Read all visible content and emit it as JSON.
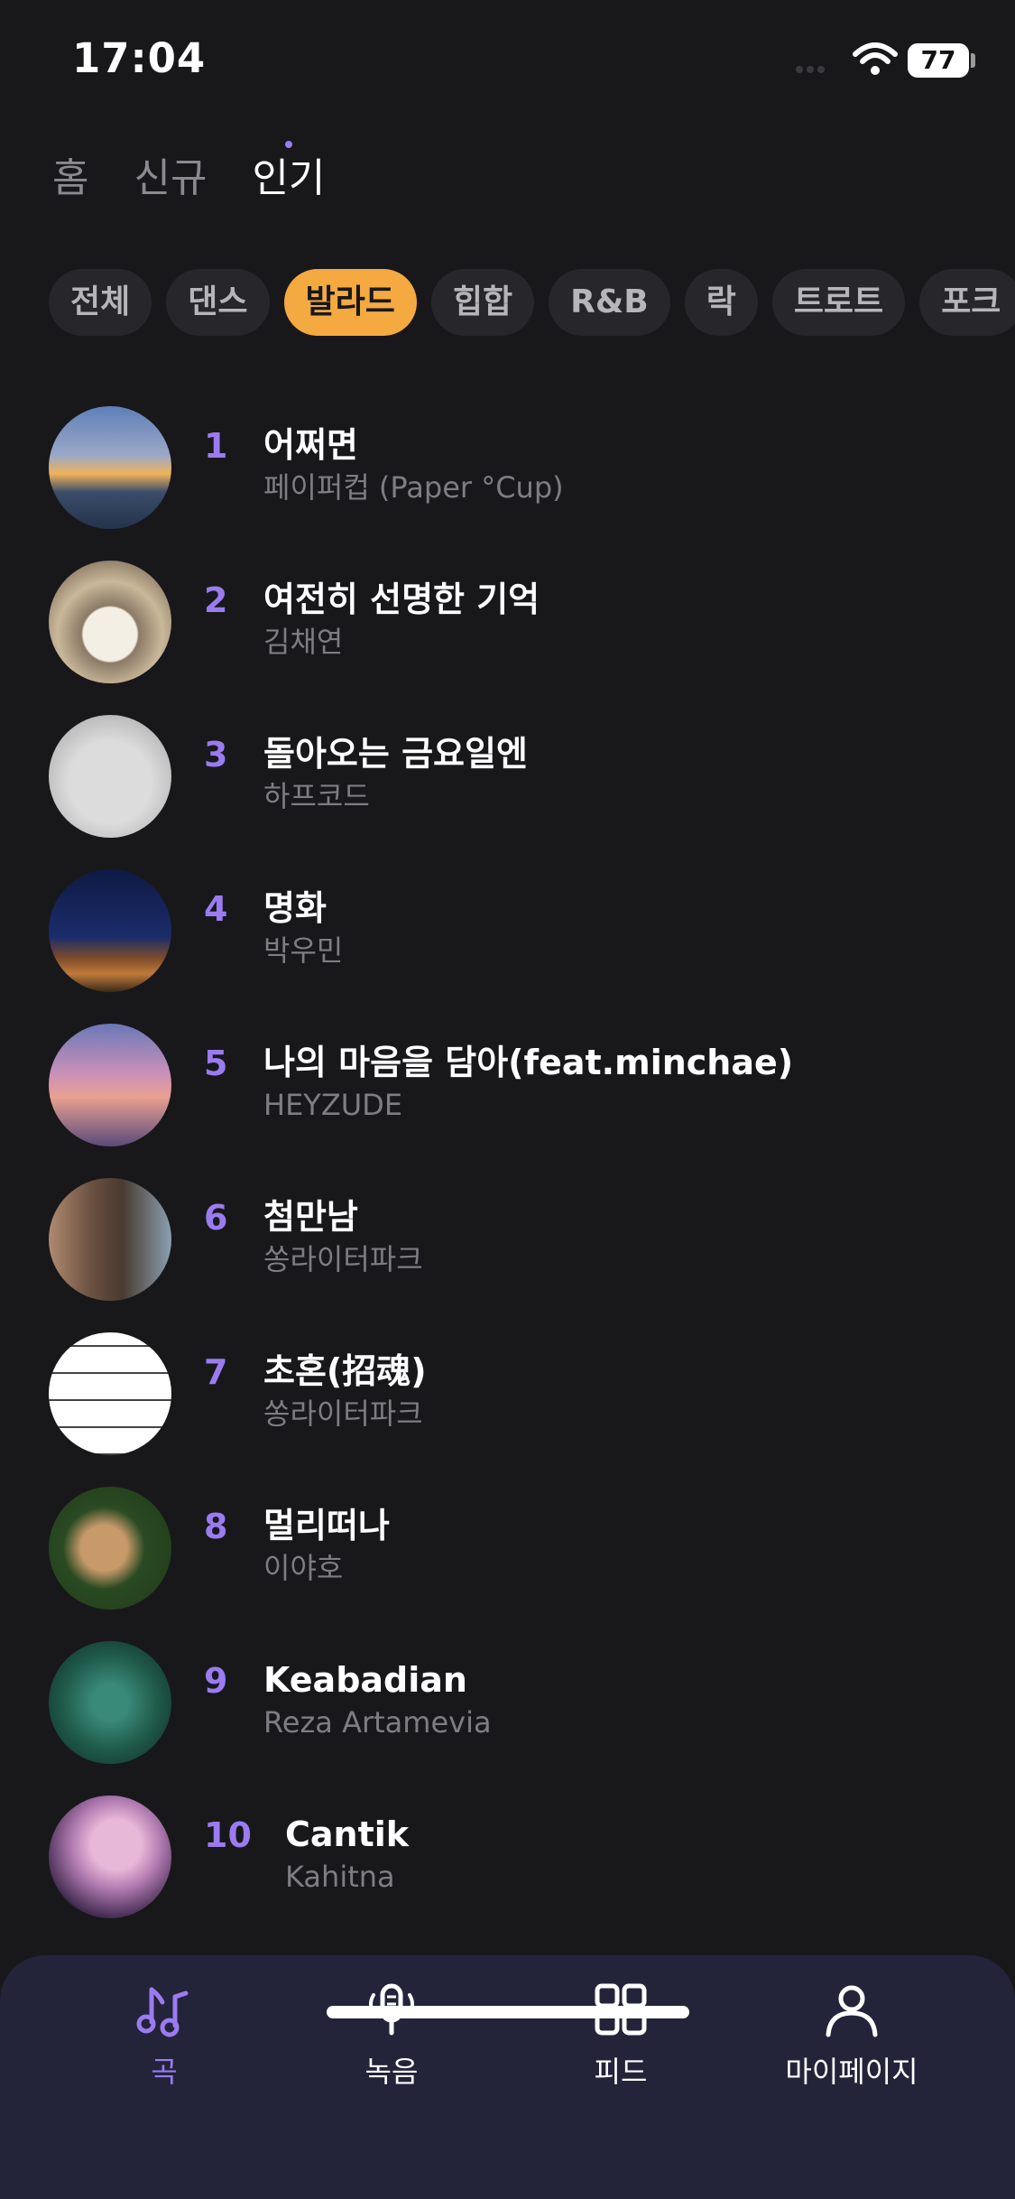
{
  "status_bar": {
    "time": "17:04",
    "battery": "77"
  },
  "top_tabs": [
    {
      "label": "홈",
      "active": false
    },
    {
      "label": "신규",
      "active": false
    },
    {
      "label": "인기",
      "active": true
    }
  ],
  "genres": [
    {
      "label": "전체",
      "active": false
    },
    {
      "label": "댄스",
      "active": false
    },
    {
      "label": "발라드",
      "active": true
    },
    {
      "label": "힙합",
      "active": false
    },
    {
      "label": "R&B",
      "active": false
    },
    {
      "label": "락",
      "active": false
    },
    {
      "label": "트로트",
      "active": false
    },
    {
      "label": "포크",
      "active": false
    }
  ],
  "songs": [
    {
      "rank": "1",
      "title": "어쩌면",
      "artist": "페이퍼컵 (Paper °Cup)"
    },
    {
      "rank": "2",
      "title": "여전히 선명한 기억",
      "artist": "김채연"
    },
    {
      "rank": "3",
      "title": "돌아오는 금요일엔",
      "artist": "하프코드"
    },
    {
      "rank": "4",
      "title": "명화",
      "artist": "박우민"
    },
    {
      "rank": "5",
      "title": "나의 마음을 담아(feat.minchae)",
      "artist": "HEYZUDE"
    },
    {
      "rank": "6",
      "title": "첨만남",
      "artist": "쏭라이터파크"
    },
    {
      "rank": "7",
      "title": "초혼(招魂)",
      "artist": "쏭라이터파크"
    },
    {
      "rank": "8",
      "title": "멀리떠나",
      "artist": "이야호"
    },
    {
      "rank": "9",
      "title": "Keabadian",
      "artist": "Reza Artamevia"
    },
    {
      "rank": "10",
      "title": "Cantik",
      "artist": "Kahitna"
    }
  ],
  "bottom_nav": [
    {
      "label": "곡",
      "icon": "music-note-icon",
      "active": true
    },
    {
      "label": "녹음",
      "icon": "microphone-icon",
      "active": false
    },
    {
      "label": "피드",
      "icon": "grid-icon",
      "active": false
    },
    {
      "label": "마이페이지",
      "icon": "person-icon",
      "active": false
    }
  ],
  "colors": {
    "accent": "#9b7bf0",
    "chip_active": "#f5a941",
    "background": "#18181b",
    "nav_background": "#23233a"
  }
}
